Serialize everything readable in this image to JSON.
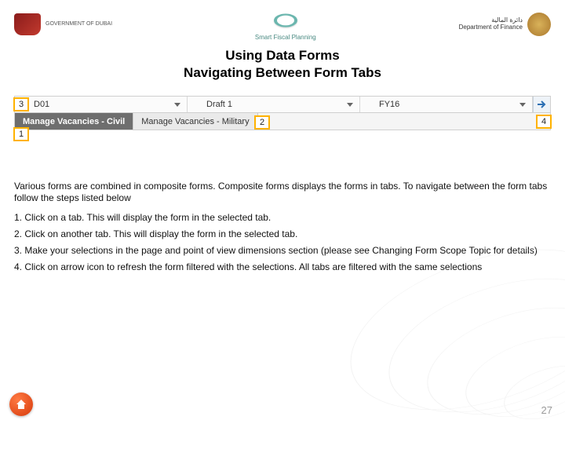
{
  "logos": {
    "left_caption": "GOVERNMENT OF DUBAI",
    "center_caption": "Smart Fiscal Planning",
    "right_caption_ar": "دائرة المالية",
    "right_caption_en": "Department of Finance"
  },
  "title": {
    "line1": "Using Data Forms",
    "line2": "Navigating Between Form Tabs"
  },
  "pov": {
    "entity": "D01",
    "scenario": "Draft 1",
    "year": "FY16"
  },
  "tabs": {
    "active": "Manage Vacancies - Civil",
    "other": "Manage Vacancies - Military"
  },
  "callouts": {
    "c1": "1",
    "c2": "2",
    "c3": "3",
    "c4": "4"
  },
  "body": {
    "intro": "Various forms are combined in composite forms. Composite forms displays the forms in tabs. To navigate between the form tabs follow the steps listed below",
    "step1": "1.  Click on a tab. This will display the form in the selected tab.",
    "step2": "2.  Click on another tab. This will display the form in the selected tab.",
    "step3": "3.  Make your selections in the page and point of view dimensions section (please see Changing Form Scope Topic for details)",
    "step4": "4.  Click on arrow icon to refresh the form filtered with the selections. All tabs are filtered with the same selections"
  },
  "page_number": "27"
}
